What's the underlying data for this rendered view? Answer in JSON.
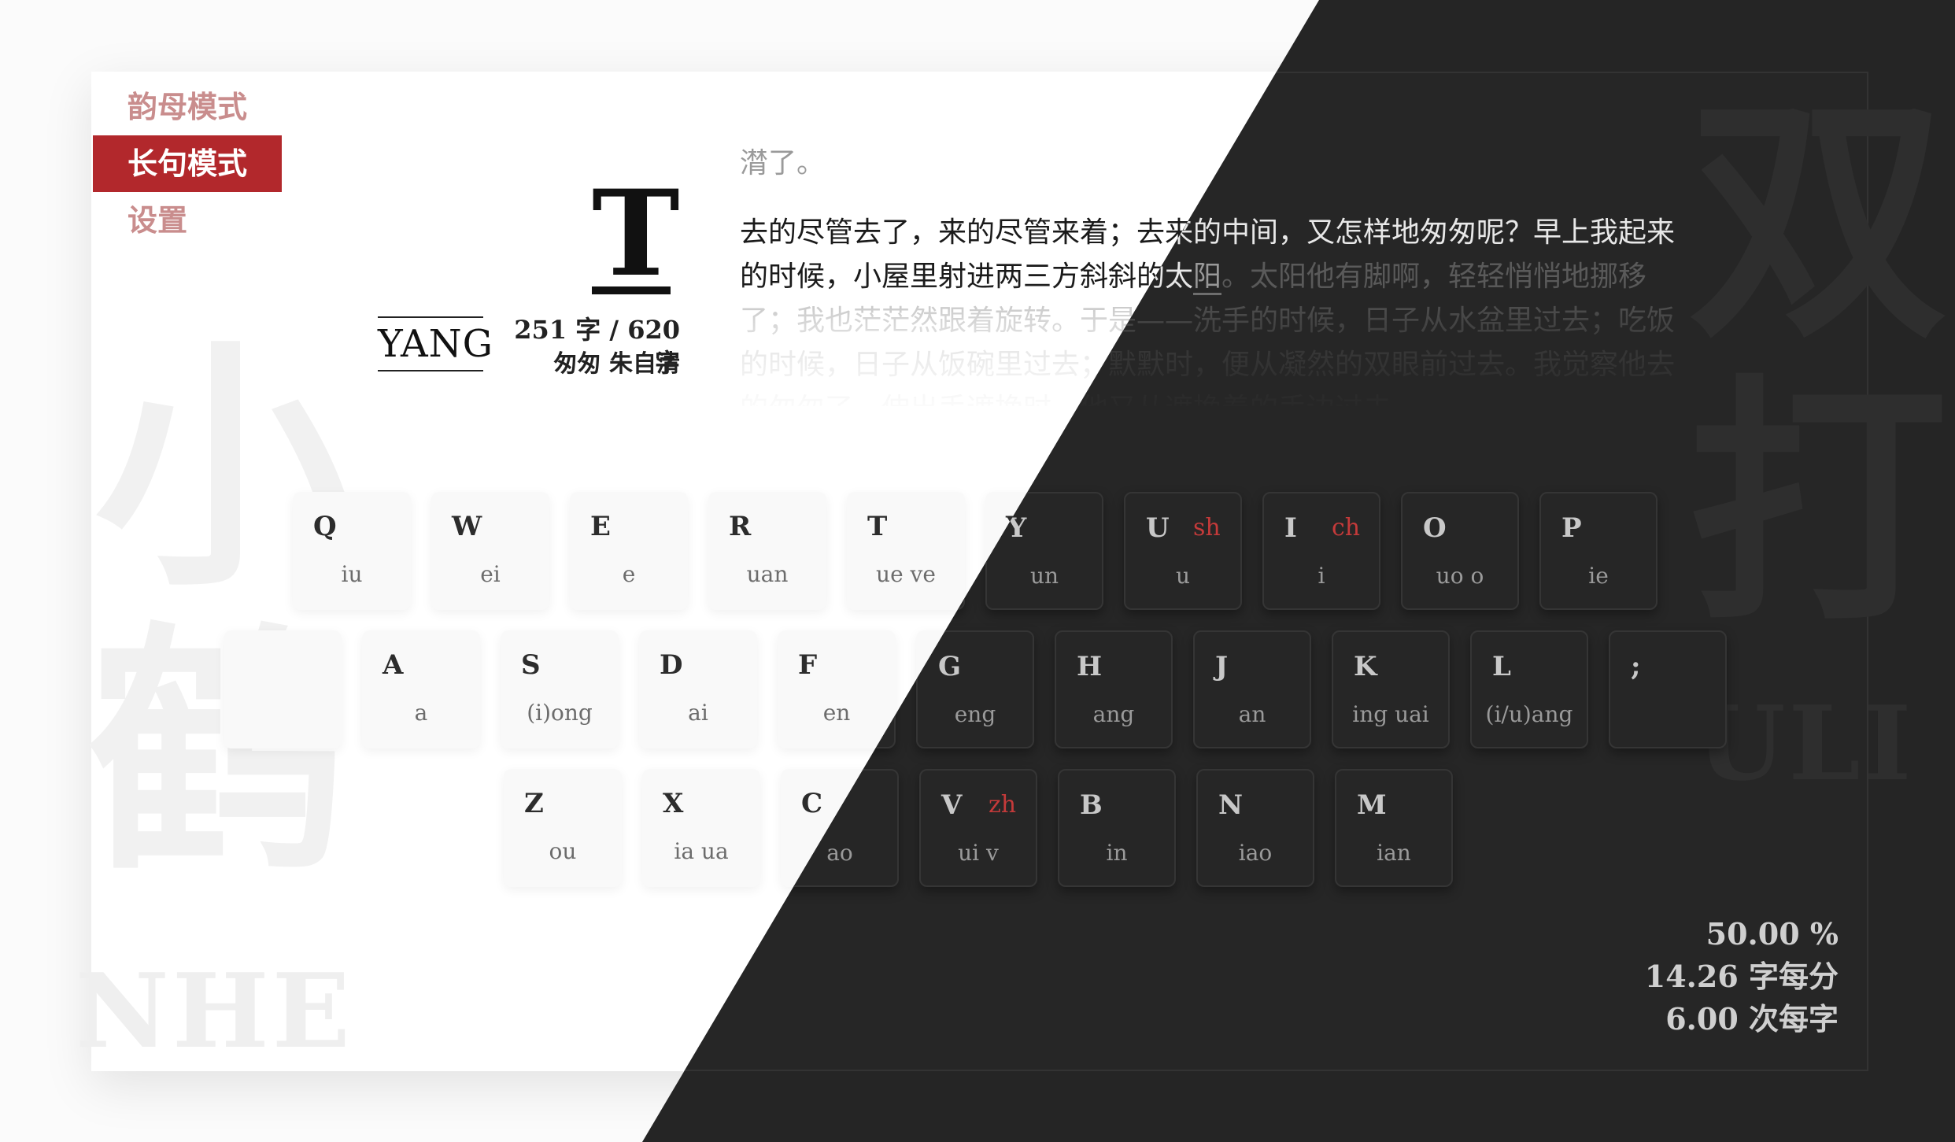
{
  "sidebar": {
    "items": [
      {
        "label": "韵母模式"
      },
      {
        "label": "长句模式"
      },
      {
        "label": "设置"
      }
    ]
  },
  "current": {
    "letter": "T",
    "pinyin": "YANG",
    "progress": "251 字 / 620 字",
    "work": "匆匆 朱自清"
  },
  "passage": {
    "previous_line": "潸了。",
    "typed": "去的尽管去了，来的尽管来着；去来的中间，又怎样地匆匆呢？早上我起来的时候，小屋里射进两三方斜斜的太",
    "cursor_char": "阳",
    "remaining": "。太阳他有脚啊，轻轻悄悄地挪移了；我也茫茫然跟着旋转。于是——洗手的时候，日子从水盆里过去；吃饭的时候，日子从饭碗里过去；默默时，便从凝然的双眼前过去。我觉察他去的匆匆了，伸出手遮挽时，他又从遮挽着的手边过去"
  },
  "watermark": {
    "left_glyphs": [
      "小",
      "鹤"
    ],
    "right_glyphs": [
      "双",
      "打"
    ],
    "left_latin": "NHE",
    "right_latin": "ULI"
  },
  "keyboard": {
    "rows": [
      [
        {
          "letter": "Q",
          "final": "iu",
          "initial": ""
        },
        {
          "letter": "W",
          "final": "ei",
          "initial": ""
        },
        {
          "letter": "E",
          "final": "e",
          "initial": ""
        },
        {
          "letter": "R",
          "final": "uan",
          "initial": ""
        },
        {
          "letter": "T",
          "final": "ue ve",
          "initial": ""
        },
        {
          "letter": "Y",
          "final": "un",
          "initial": ""
        },
        {
          "letter": "U",
          "final": "u",
          "initial": "sh"
        },
        {
          "letter": "I",
          "final": "i",
          "initial": "ch"
        },
        {
          "letter": "O",
          "final": "uo o",
          "initial": ""
        },
        {
          "letter": "P",
          "final": "ie",
          "initial": ""
        }
      ],
      [
        {
          "letter": "",
          "final": "",
          "initial": ""
        },
        {
          "letter": "A",
          "final": "a",
          "initial": ""
        },
        {
          "letter": "S",
          "final": "(i)ong",
          "initial": ""
        },
        {
          "letter": "D",
          "final": "ai",
          "initial": ""
        },
        {
          "letter": "F",
          "final": "en",
          "initial": ""
        },
        {
          "letter": "G",
          "final": "eng",
          "initial": ""
        },
        {
          "letter": "H",
          "final": "ang",
          "initial": ""
        },
        {
          "letter": "J",
          "final": "an",
          "initial": ""
        },
        {
          "letter": "K",
          "final": "ing uai",
          "initial": ""
        },
        {
          "letter": "L",
          "final": "(i/u)ang",
          "initial": ""
        },
        {
          "letter": ";",
          "final": "",
          "initial": ""
        }
      ],
      [
        {
          "letter": "Z",
          "final": "ou",
          "initial": ""
        },
        {
          "letter": "X",
          "final": "ia ua",
          "initial": ""
        },
        {
          "letter": "C",
          "final": "ao",
          "initial": ""
        },
        {
          "letter": "V",
          "final": "ui v",
          "initial": "zh"
        },
        {
          "letter": "B",
          "final": "in",
          "initial": ""
        },
        {
          "letter": "N",
          "final": "iao",
          "initial": ""
        },
        {
          "letter": "M",
          "final": "ian",
          "initial": ""
        }
      ]
    ]
  },
  "stats": {
    "accuracy": "50.00 %",
    "speed": "14.26 字每分",
    "keystrokes": "6.00 次每字"
  },
  "colors": {
    "accent": "#b2282c",
    "initial_highlight": "#d03a3a",
    "dark_background": "#252525"
  }
}
